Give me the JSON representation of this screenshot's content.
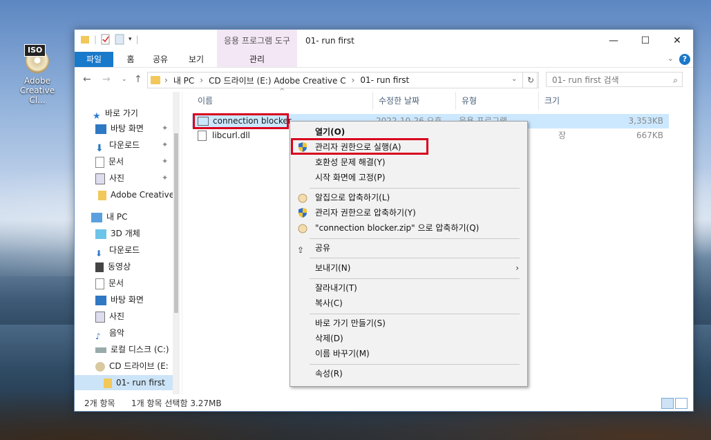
{
  "desktop": {
    "icon_tag": "ISO",
    "icon_label": "Adobe Creative Cl..."
  },
  "window": {
    "tool_header": "응용 프로그램 도구",
    "title": "01- run first",
    "tabs": {
      "file": "파일",
      "home": "홈",
      "share": "공유",
      "view": "보기",
      "manage": "관리"
    },
    "controls": {
      "minimize": "—",
      "maximize": "☐",
      "close": "✕"
    }
  },
  "address": {
    "path": [
      "내 PC",
      "CD 드라이브 (E:) Adobe Creative C",
      "01- run first"
    ],
    "search_placeholder": "01- run first 검색"
  },
  "nav": {
    "quick_access": "바로 가기",
    "items": [
      {
        "label": "바탕 화면",
        "pinned": true
      },
      {
        "label": "다운로드",
        "pinned": true
      },
      {
        "label": "문서",
        "pinned": true
      },
      {
        "label": "사진",
        "pinned": true
      },
      {
        "label": "Adobe Creative",
        "pinned": false
      }
    ],
    "this_pc": "내 PC",
    "pc_items": [
      "3D 개체",
      "다운로드",
      "동영상",
      "문서",
      "바탕 화면",
      "사진",
      "음악",
      "로컬 디스크 (C:)",
      "CD 드라이브 (E:",
      "01- run first"
    ]
  },
  "list": {
    "columns": {
      "name": "이름",
      "date": "수정한 날짜",
      "type": "유형",
      "size": "크기"
    },
    "rows": [
      {
        "name": "connection blocker",
        "date": "2022-10-26 오후",
        "type": "응용 프로그램",
        "size": "3,353KB"
      },
      {
        "name": "libcurl.dll",
        "date": "",
        "type": "장",
        "size": "667KB"
      }
    ]
  },
  "status": {
    "count": "2개 항목",
    "selected": "1개 항목 선택함 3.27MB"
  },
  "context_menu": {
    "open": "열기(O)",
    "run_admin": "관리자 권한으로 실행(A)",
    "troubleshoot": "호환성 문제 해결(Y)",
    "pin_start": "시작 화면에 고정(P)",
    "zip_alzip": "알집으로 압축하기(L)",
    "zip_admin": "관리자 권한으로 압축하기(Y)",
    "zip_named": "\"connection blocker.zip\" 으로 압축하기(Q)",
    "share": "공유",
    "send_to": "보내기(N)",
    "cut": "잘라내기(T)",
    "copy": "복사(C)",
    "shortcut": "바로 가기 만들기(S)",
    "delete": "삭제(D)",
    "rename": "이름 바꾸기(M)",
    "properties": "속성(R)"
  }
}
